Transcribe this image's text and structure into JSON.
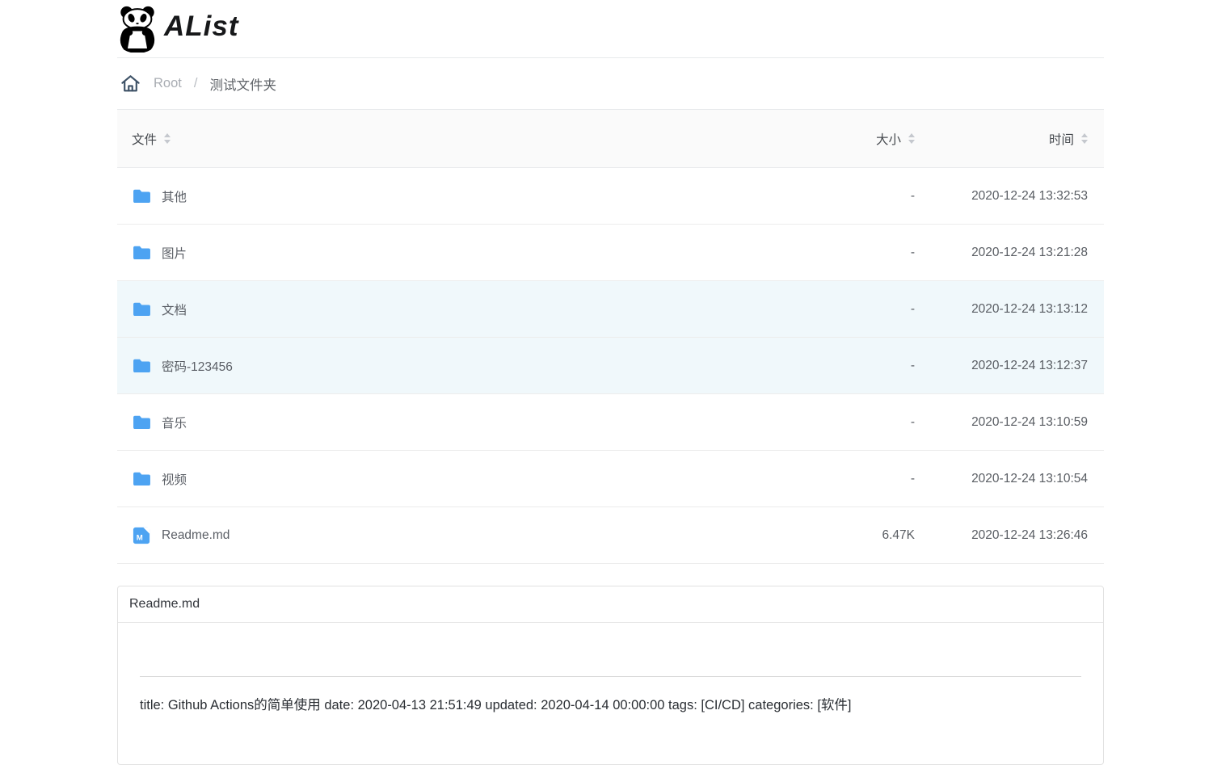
{
  "app": {
    "name": "AList",
    "logo_icon": "panda-icon"
  },
  "breadcrumb": {
    "home_icon": "home-icon",
    "root_label": "Root",
    "separator": "/",
    "current_label": "测试文件夹"
  },
  "file_table": {
    "columns": [
      {
        "label": "文件",
        "sortable": true
      },
      {
        "label": "大小",
        "sortable": true
      },
      {
        "label": "时间",
        "sortable": true
      }
    ],
    "rows": [
      {
        "name": "其他",
        "type": "folder",
        "size": "-",
        "time": "2020-12-24 13:32:53",
        "highlighted": false
      },
      {
        "name": "图片",
        "type": "folder",
        "size": "-",
        "time": "2020-12-24 13:21:28",
        "highlighted": false
      },
      {
        "name": "文档",
        "type": "folder",
        "size": "-",
        "time": "2020-12-24 13:13:12",
        "highlighted": true
      },
      {
        "name": "密码-123456",
        "type": "folder",
        "size": "-",
        "time": "2020-12-24 13:12:37",
        "highlighted": true
      },
      {
        "name": "音乐",
        "type": "folder",
        "size": "-",
        "time": "2020-12-24 13:10:59",
        "highlighted": false
      },
      {
        "name": "视频",
        "type": "folder",
        "size": "-",
        "time": "2020-12-24 13:10:54",
        "highlighted": false
      },
      {
        "name": "Readme.md",
        "type": "markdown",
        "size": "6.47K",
        "time": "2020-12-24 13:26:46",
        "highlighted": false
      }
    ]
  },
  "preview": {
    "title": "Readme.md",
    "content": "title: Github Actions的简单使用 date: 2020-04-13 21:51:49 updated: 2020-04-14 00:00:00 tags: [CI/CD] categories: [软件]"
  },
  "colors": {
    "accent_blue": "#4da3f2",
    "row_highlight": "#f0f8fb",
    "border": "#e8eaec",
    "header_bg": "#fafafa"
  }
}
